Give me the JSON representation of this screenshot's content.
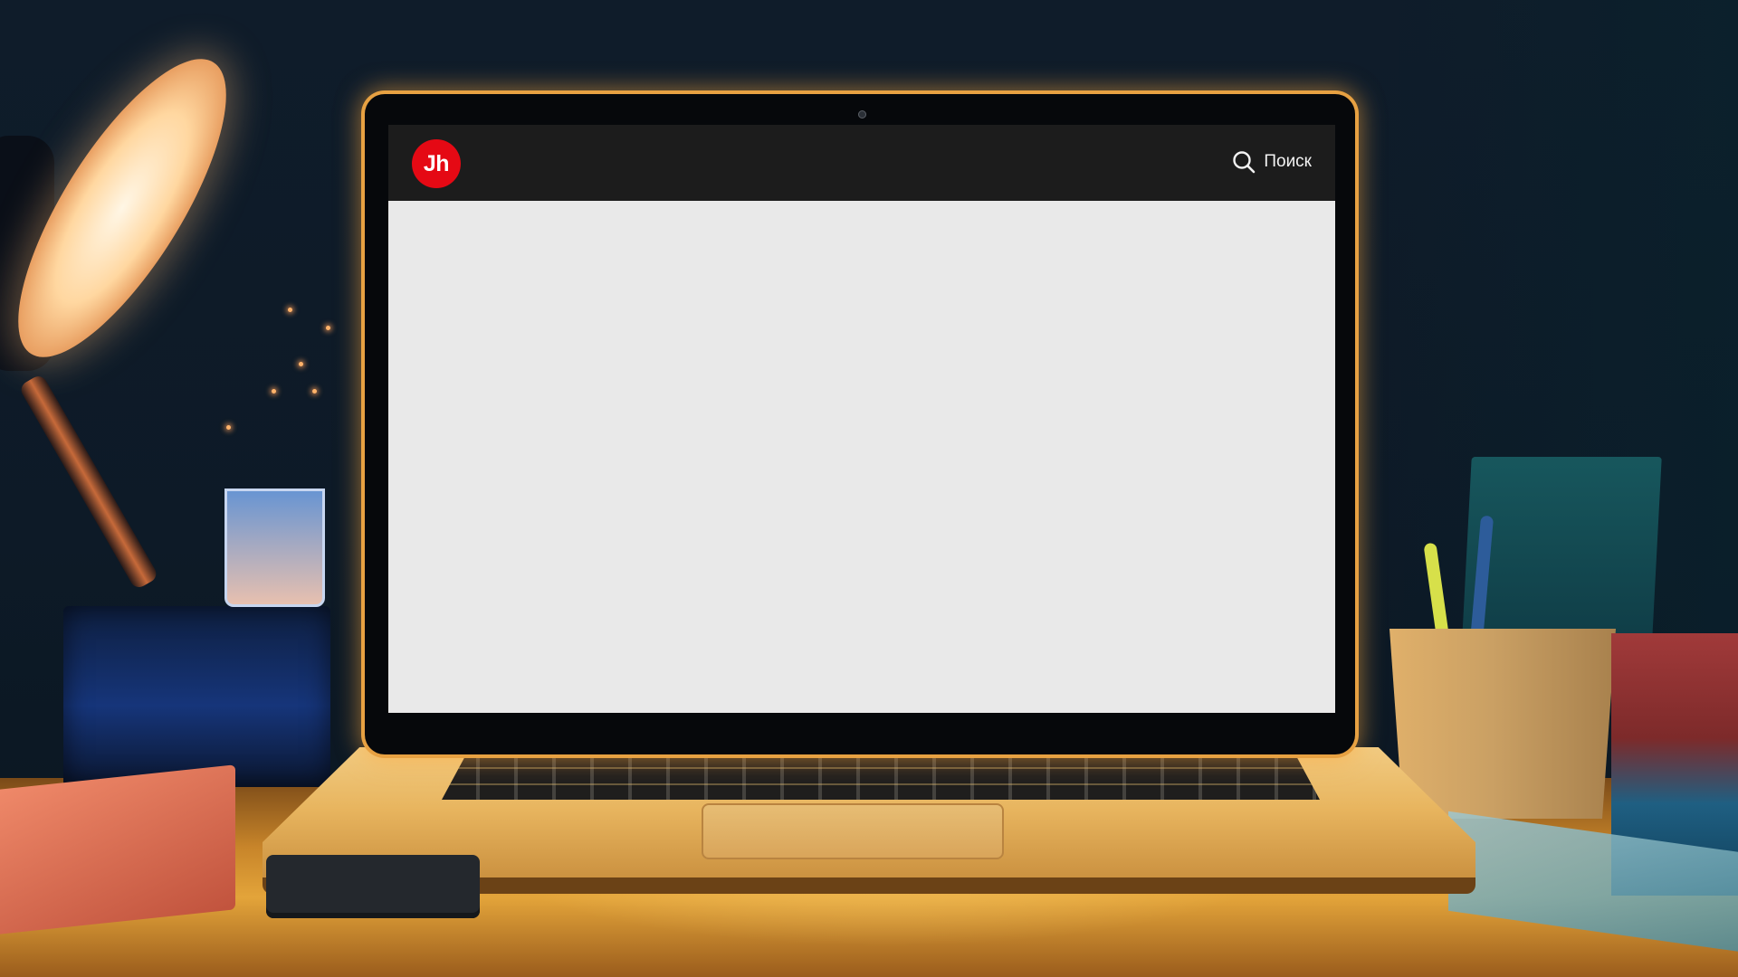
{
  "app": {
    "logo_text": "Jh",
    "logo_color": "#e50914",
    "header_color": "#1c1c1c",
    "content_color": "#e9e9e9"
  },
  "header": {
    "search": {
      "icon": "search-icon",
      "label": "Поиск"
    }
  }
}
